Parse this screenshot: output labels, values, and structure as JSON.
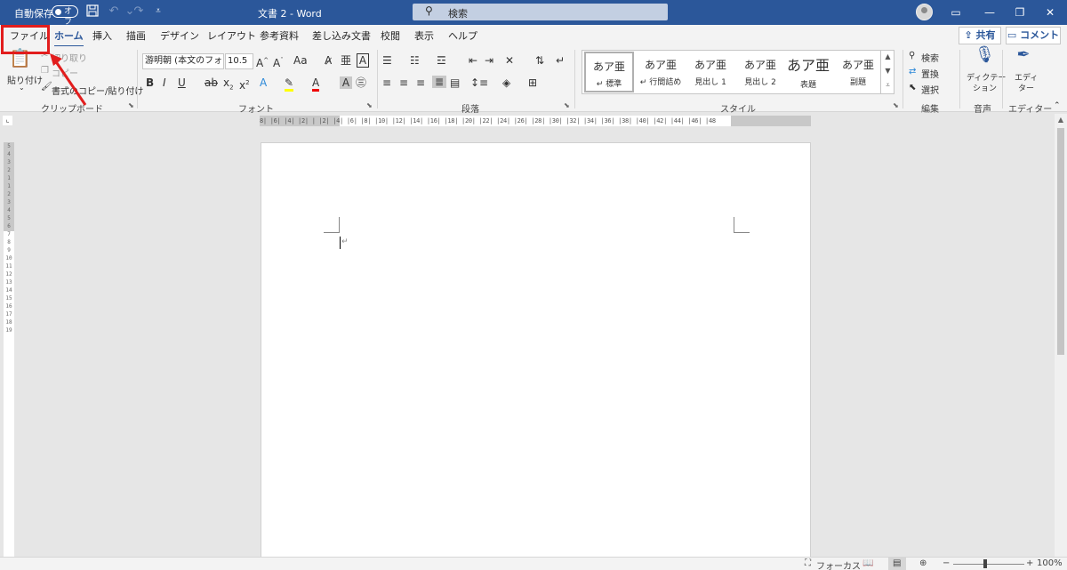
{
  "titlebar": {
    "autosave_label": "自動保存",
    "autosave_toggle": "オフ",
    "doc_title": "文書 2  -  Word",
    "search_placeholder": "検索"
  },
  "tabs": {
    "file": "ファイル",
    "home": "ホーム",
    "insert": "挿入",
    "draw": "描画",
    "design": "デザイン",
    "layout": "レイアウト",
    "references": "参考資料",
    "mailings": "差し込み文書",
    "review": "校閲",
    "view": "表示",
    "help": "ヘルプ",
    "share": "共有",
    "comment": "コメント"
  },
  "ribbon": {
    "clipboard": {
      "paste": "貼り付け",
      "cut": "切り取り",
      "copy": "コピー",
      "format_painter": "書式のコピー/貼り付け",
      "label": "クリップボード"
    },
    "font": {
      "font_name": "游明朝 (本文のフォン",
      "font_size": "10.5",
      "label": "フォント"
    },
    "paragraph": {
      "label": "段落"
    },
    "styles": {
      "items": [
        {
          "sample": "あア亜",
          "name": "↵ 標準"
        },
        {
          "sample": "あア亜",
          "name": "↵ 行間詰め"
        },
        {
          "sample": "あア亜",
          "name": "見出し 1"
        },
        {
          "sample": "あア亜",
          "name": "見出し 2"
        },
        {
          "sample": "あア亜",
          "name": "表題"
        },
        {
          "sample": "あア亜",
          "name": "副題"
        }
      ],
      "label": "スタイル"
    },
    "editing": {
      "find": "検索",
      "replace": "置換",
      "select": "選択",
      "label": "編集"
    },
    "voice": {
      "dictate_line1": "ディクテー",
      "dictate_line2": "ション",
      "label": "音声"
    },
    "editor": {
      "editor_line1": "エディ",
      "editor_line2": "ター",
      "label": "エディター"
    }
  },
  "ruler": {
    "h_ticks": "8| |6| |4| |2| |  |2| |4| |6| |8| |10| |12| |14| |16| |18| |20| |22| |24| |26| |28| |30| |32| |34| |36| |38| |40| |42| |44| |46| |48",
    "v_ticks": "5 4 3 2 1 1 2 3 4 5 6 7 8 9 10 11 12 13 14 15 16 17 18 19"
  },
  "document": {
    "paragraph_mark": "↵"
  },
  "statusbar": {
    "focus": "フォーカス",
    "zoom_minus": "−",
    "zoom_plus": "+",
    "zoom_level": "100%"
  },
  "icons": {
    "save": "save-icon",
    "undo": "undo-icon",
    "redo": "redo-icon",
    "search": "search-icon"
  },
  "colors": {
    "titlebar": "#2b579a",
    "highlight_annotation": "#e21d1d",
    "ribbon_bg": "#f3f3f3"
  }
}
